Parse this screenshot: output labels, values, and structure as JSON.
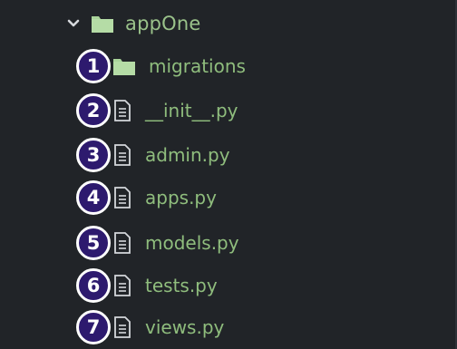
{
  "tree": {
    "root": {
      "label": "appOne",
      "icon": "folder-icon",
      "expanded_icon": "chevron-down-icon"
    },
    "items": [
      {
        "badge": "1",
        "label": "migrations",
        "icon": "folder-icon"
      },
      {
        "badge": "2",
        "label": "__init__.py",
        "icon": "file-icon"
      },
      {
        "badge": "3",
        "label": "admin.py",
        "icon": "file-icon"
      },
      {
        "badge": "4",
        "label": "apps.py",
        "icon": "file-icon"
      },
      {
        "badge": "5",
        "label": "models.py",
        "icon": "file-icon"
      },
      {
        "badge": "6",
        "label": "tests.py",
        "icon": "file-icon"
      },
      {
        "badge": "7",
        "label": "views.py",
        "icon": "file-icon"
      }
    ]
  },
  "colors": {
    "background": "#212428",
    "label_green": "#8fbd7d",
    "folder_green": "#9ac28a",
    "badge_fill": "#2d1a6e",
    "badge_border": "#ffffff"
  }
}
